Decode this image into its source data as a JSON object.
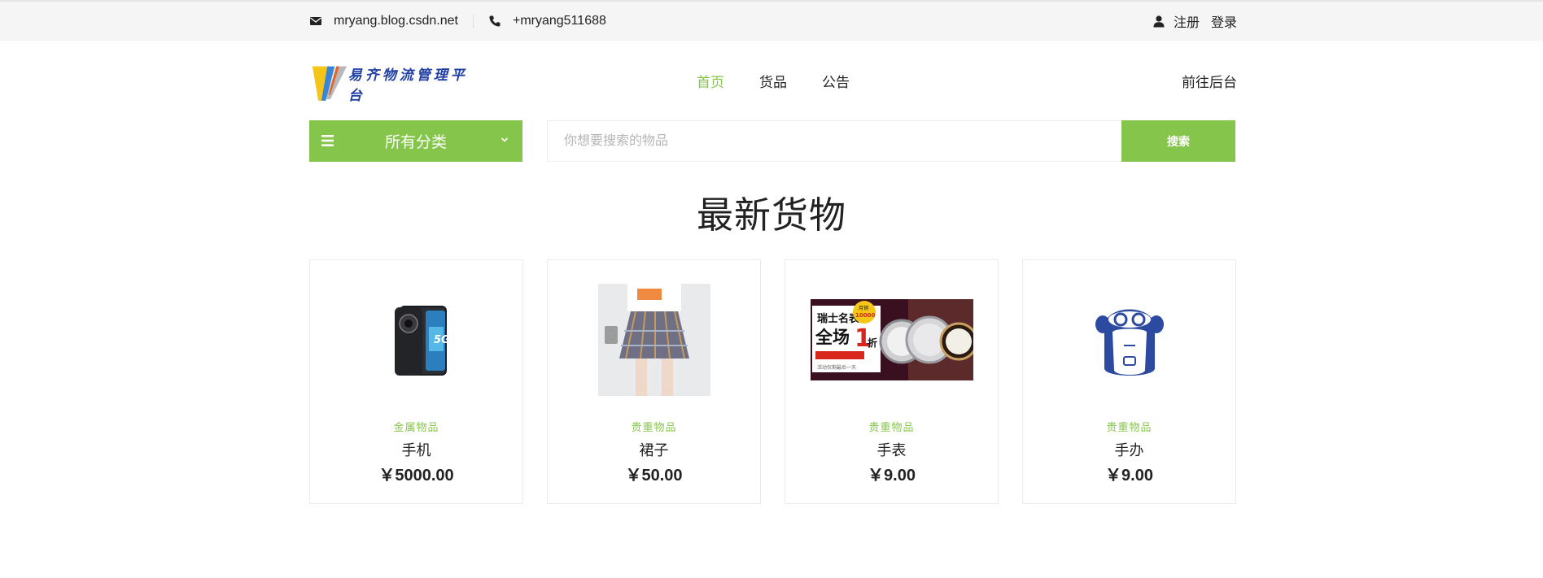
{
  "topbar": {
    "email_icon": "envelope-icon",
    "email": "mryang.blog.csdn.net",
    "phone_icon": "phone-icon",
    "phone": "+mryang511688",
    "user_icon": "user-icon",
    "register": "注册",
    "login": "登录"
  },
  "logo": {
    "text": "易齐物流管理平台"
  },
  "nav": {
    "items": [
      {
        "label": "首页",
        "active": true
      },
      {
        "label": "货品",
        "active": false
      },
      {
        "label": "公告",
        "active": false
      }
    ],
    "backend": "前往后台"
  },
  "category": {
    "icon": "menu-icon",
    "label": "所有分类",
    "chevron": "chevron-down-icon"
  },
  "search": {
    "placeholder": "你想要搜索的物品",
    "button": "搜索"
  },
  "section": {
    "title": "最新货物"
  },
  "products": [
    {
      "category": "金属物品",
      "name": "手机",
      "price": "￥5000.00",
      "image": "phone-image"
    },
    {
      "category": "贵重物品",
      "name": "裙子",
      "price": "￥50.00",
      "image": "skirt-image"
    },
    {
      "category": "贵重物品",
      "name": "手表",
      "price": "￥9.00",
      "image": "watch-ad-image"
    },
    {
      "category": "贵重物品",
      "name": "手办",
      "price": "￥9.00",
      "image": "monkey-figure-image"
    }
  ],
  "watch_ad": {
    "line1": "瑞士名表",
    "line2": "全场",
    "number": "1",
    "unit": "折",
    "badge_top": "月销",
    "badge_num": "10000",
    "small": "活动仅剩最后一天"
  },
  "colors": {
    "accent": "#86c54c",
    "topbar_bg": "#f5f5f5",
    "text": "#222222"
  }
}
